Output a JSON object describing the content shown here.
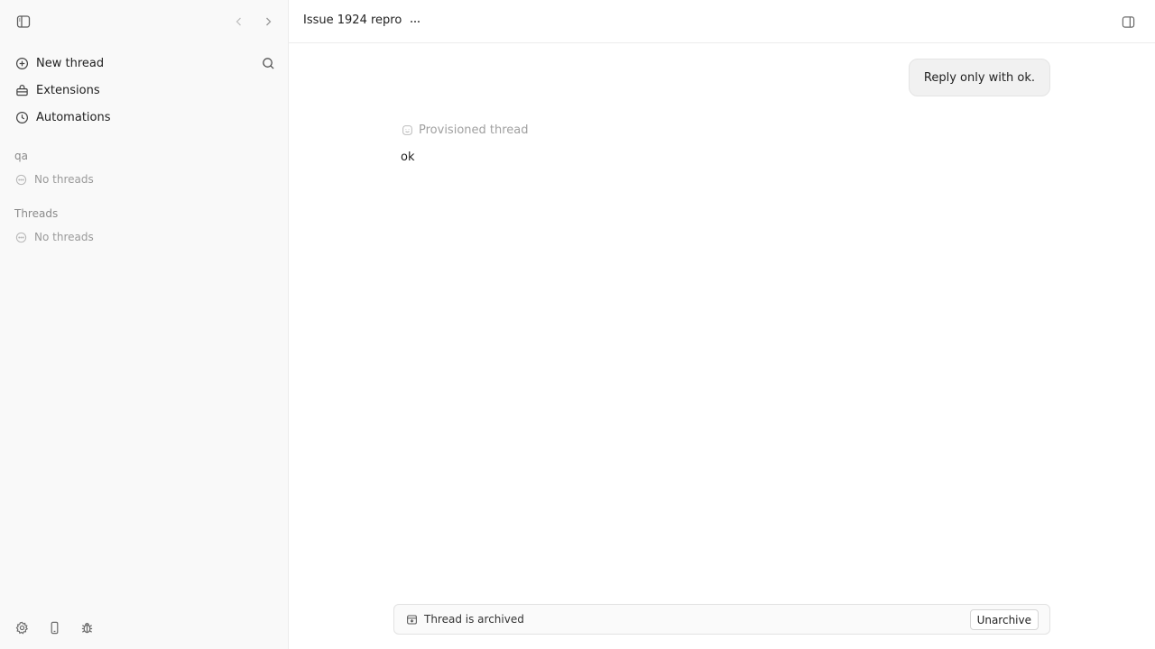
{
  "sidebar": {
    "menu": {
      "new_thread": "New thread",
      "extensions": "Extensions",
      "automations": "Automations"
    },
    "groups": [
      {
        "label": "qa",
        "empty_text": "No threads"
      },
      {
        "label": "Threads",
        "empty_text": "No threads"
      }
    ],
    "icons": {
      "toggle": "sidebar-toggle-icon",
      "back": "chevron-left-icon",
      "forward": "chevron-right-icon",
      "search": "search-icon",
      "new_thread": "plus-circle-icon",
      "extensions": "extensions-icon",
      "automations": "clock-icon",
      "settings": "gear-icon",
      "device": "phone-icon",
      "debug": "bug-icon"
    }
  },
  "header": {
    "title": "Issue 1924 repro"
  },
  "conversation": {
    "user_message": "Reply only with ok.",
    "assistant_status": "Provisioned thread",
    "assistant_reply": "ok"
  },
  "archive_bar": {
    "text": "Thread is archived",
    "button_label": "Unarchive"
  },
  "colors": {
    "sidebar_bg": "#f9f9f9",
    "bubble_bg": "#f1f1f1",
    "muted_text": "#9a9a9a"
  }
}
